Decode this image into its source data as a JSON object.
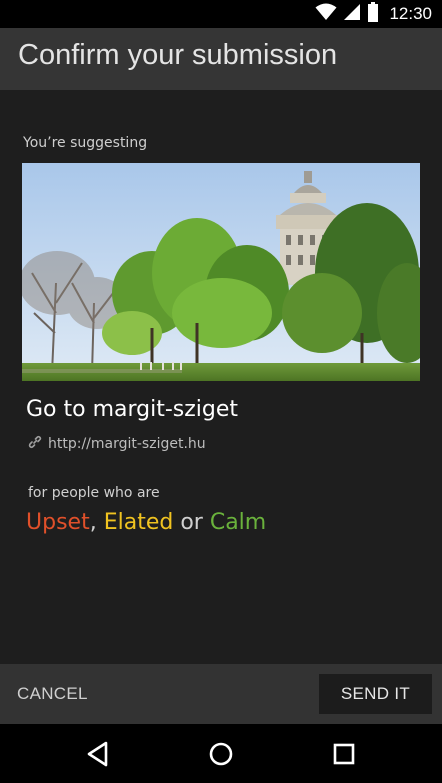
{
  "status_bar": {
    "time": "12:30",
    "icons": [
      "wifi-icon",
      "cell-signal-icon",
      "battery-icon"
    ]
  },
  "app_bar": {
    "title": "Confirm your submission"
  },
  "content": {
    "suggesting_label": "You’re suggesting",
    "photo_subject": "margit-sziget-photo",
    "place_title": "Go to margit-sziget",
    "url_icon": "link-icon",
    "url": "http://margit-sziget.hu",
    "people_label": "for people who are",
    "moods": [
      {
        "label": "Upset",
        "color": "#e0502a"
      },
      {
        "label": "Elated",
        "color": "#f0c320"
      },
      {
        "label": "Calm",
        "color": "#6ab23c"
      }
    ],
    "mood_separators": [
      ", ",
      " or "
    ]
  },
  "actions": {
    "cancel_label": "CANCEL",
    "send_label": "SEND IT"
  },
  "nav_bar": {
    "icons": [
      "back-icon",
      "home-icon",
      "recents-icon"
    ]
  }
}
